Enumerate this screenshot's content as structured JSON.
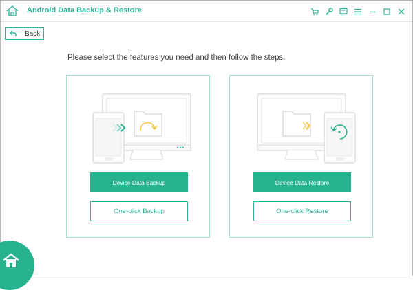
{
  "titlebar": {
    "title": "Android Data Backup & Restore",
    "icons": [
      "home-icon",
      "cart-icon",
      "key-icon",
      "feedback-icon",
      "menu-icon",
      "minimize-icon",
      "maximize-icon",
      "close-icon"
    ]
  },
  "back_label": "Back",
  "instruction": "Please select the features you need and then follow the steps.",
  "cards": [
    {
      "primary": "Device Data Backup",
      "secondary": "One-click Backup"
    },
    {
      "primary": "Device Data Restore",
      "secondary": "One-click Restore"
    }
  ],
  "colors": {
    "accent": "#27b38f",
    "accent_text": "#2fb59a",
    "yellow": "#f5c842",
    "border": "#9fded0"
  }
}
